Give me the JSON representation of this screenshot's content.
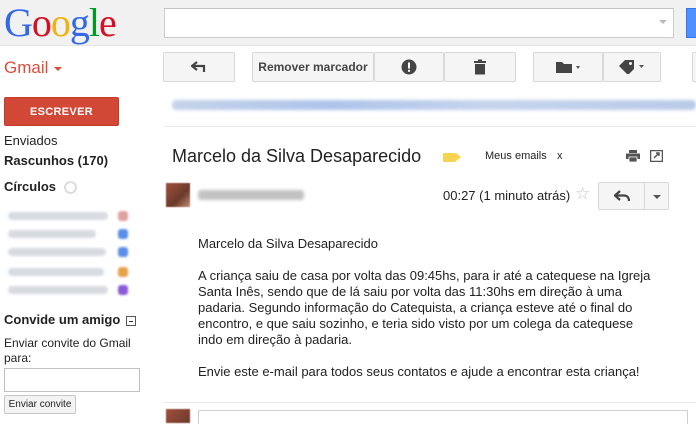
{
  "header": {
    "logo_letters": [
      {
        "ch": "G",
        "color": "#3369e8"
      },
      {
        "ch": "o",
        "color": "#d50f25"
      },
      {
        "ch": "o",
        "color": "#eeb211"
      },
      {
        "ch": "g",
        "color": "#3369e8"
      },
      {
        "ch": "l",
        "color": "#009925"
      },
      {
        "ch": "e",
        "color": "#d50f25"
      }
    ],
    "search_value": ""
  },
  "app": {
    "name": "Gmail"
  },
  "toolbar": {
    "back_icon": "back-arrow-icon",
    "remove_label": "Remover marcador",
    "spam_icon": "report-spam-icon",
    "delete_icon": "trash-icon",
    "move_icon": "folder-icon",
    "labels_icon": "label-tag-icon"
  },
  "sidebar": {
    "compose_label": "ESCREVER",
    "items": [
      {
        "label": "Enviados",
        "bold": false
      },
      {
        "label": "Rascunhos (170)",
        "bold": true
      }
    ],
    "circles_label": "Círculos",
    "contact_colors": [
      "#e0a0a0",
      "#5b8ee8",
      "#5b8ee8",
      "#e8a04a",
      "#8a5ad8"
    ],
    "invite": {
      "title": "Convide um amigo",
      "text": "Enviar convite do Gmail para:",
      "input_value": "",
      "button_label": "Enviar convite"
    }
  },
  "message": {
    "subject": "Marcelo da Silva Desaparecido",
    "label_name": "Meus emails",
    "label_remove": "x",
    "label_color": "#f5d44f",
    "time": "00:27 (1 minuto atrás)",
    "body": [
      "Marcelo da Silva Desaparecido",
      "A criança saiu de casa por volta das 09:45hs, para ir até a catequese na Igreja Santa Inês, sendo que de lá saiu por volta das 11:30hs em direção à uma padaria. Segundo informação do Catequista, a criança esteve até o final do encontro, e que saiu sozinho, e teria sido visto por um colega da catequese indo em direção à padaria.",
      "Envie este e-mail para todos seus contatos e ajude a encontrar esta criança!"
    ]
  }
}
